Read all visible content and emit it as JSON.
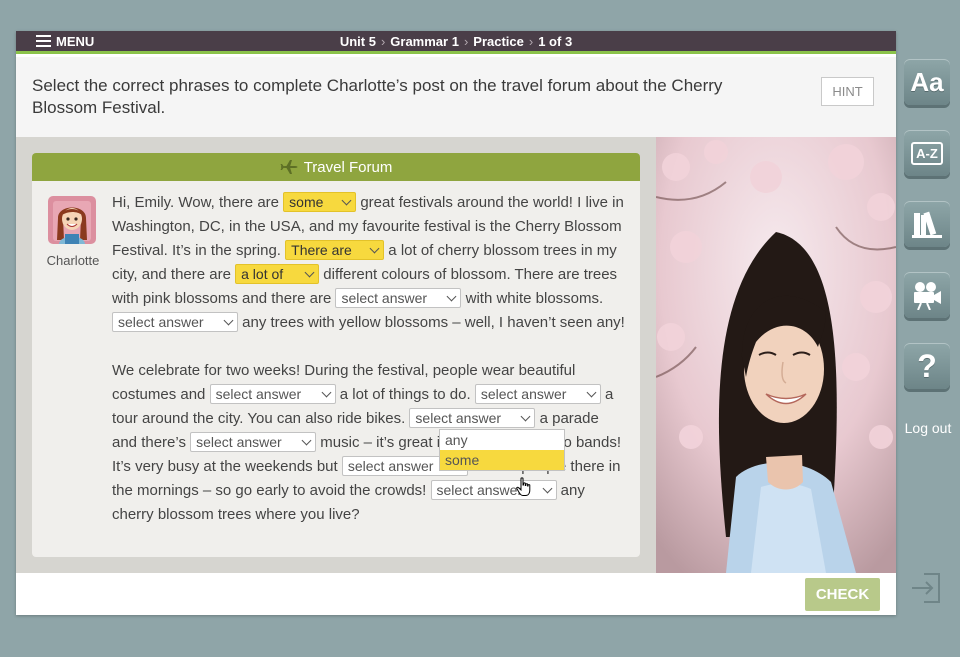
{
  "topbar": {
    "menu_label": "MENU",
    "breadcrumb": [
      "Unit 5",
      "Grammar 1",
      "Practice",
      "1 of 3"
    ]
  },
  "instruction": "Select the correct phrases to complete Charlotte’s post on the travel forum about the Cherry Blossom Festival.",
  "hint_label": "HINT",
  "forum": {
    "title": "Travel Forum",
    "title_icon": "airplane-icon",
    "author": "Charlotte",
    "p1": {
      "t1": "Hi, Emily. Wow, there are ",
      "s1": "some",
      "t2": " great festivals around the world! I live in Washington, DC, in the USA, and my favourite festival is the Cherry Blossom Festival. It’s in the spring. ",
      "s2": "There are",
      "t3": " a lot of cherry blossom trees in my city, and there are ",
      "s3": "a lot of",
      "t4": " different colours of blossom. There are trees with pink blossoms and there are ",
      "s4": "select answer",
      "t5": " with white blossoms. ",
      "s5": "select answer",
      "t6": " any trees with yellow blossoms – well, I haven’t seen any!"
    },
    "p2": {
      "t1": "We celebrate for two weeks! During the festival, people wear beautiful costumes and ",
      "s1": "select answer",
      "t2": " a lot of things to do. ",
      "s2": "select answer",
      "t3": " a tour around the city. You can also ride bikes. ",
      "s3": "select answer",
      "t4": " a parade and there’s ",
      "s4": "select answer",
      "t5": " music – it’s great if you like to listen to bands! It’s very busy at the weekends but ",
      "s5": "select answer",
      "t6": " a lot of people there in the mornings – so go early to avoid the crowds! ",
      "s6": "select answer",
      "t7": " any cherry blossom trees where you live?"
    },
    "dropdown_options": [
      "any",
      "some"
    ],
    "dropdown_highlighted": "some"
  },
  "footer": {
    "check_label": "CHECK"
  },
  "sidebar": {
    "font_size_label": "Aa",
    "glossary_label": "A-Z",
    "library_icon": "books-icon",
    "video_icon": "video-camera-icon",
    "help_label": "?",
    "logout_label": "Log out"
  },
  "colors": {
    "topbar": "#4a3e48",
    "accent_green": "#8bc34a",
    "forum_header": "#8fa53f",
    "selected_yellow": "#f7d93e",
    "check_button": "#b8c98a",
    "background": "#8fa5a8"
  }
}
